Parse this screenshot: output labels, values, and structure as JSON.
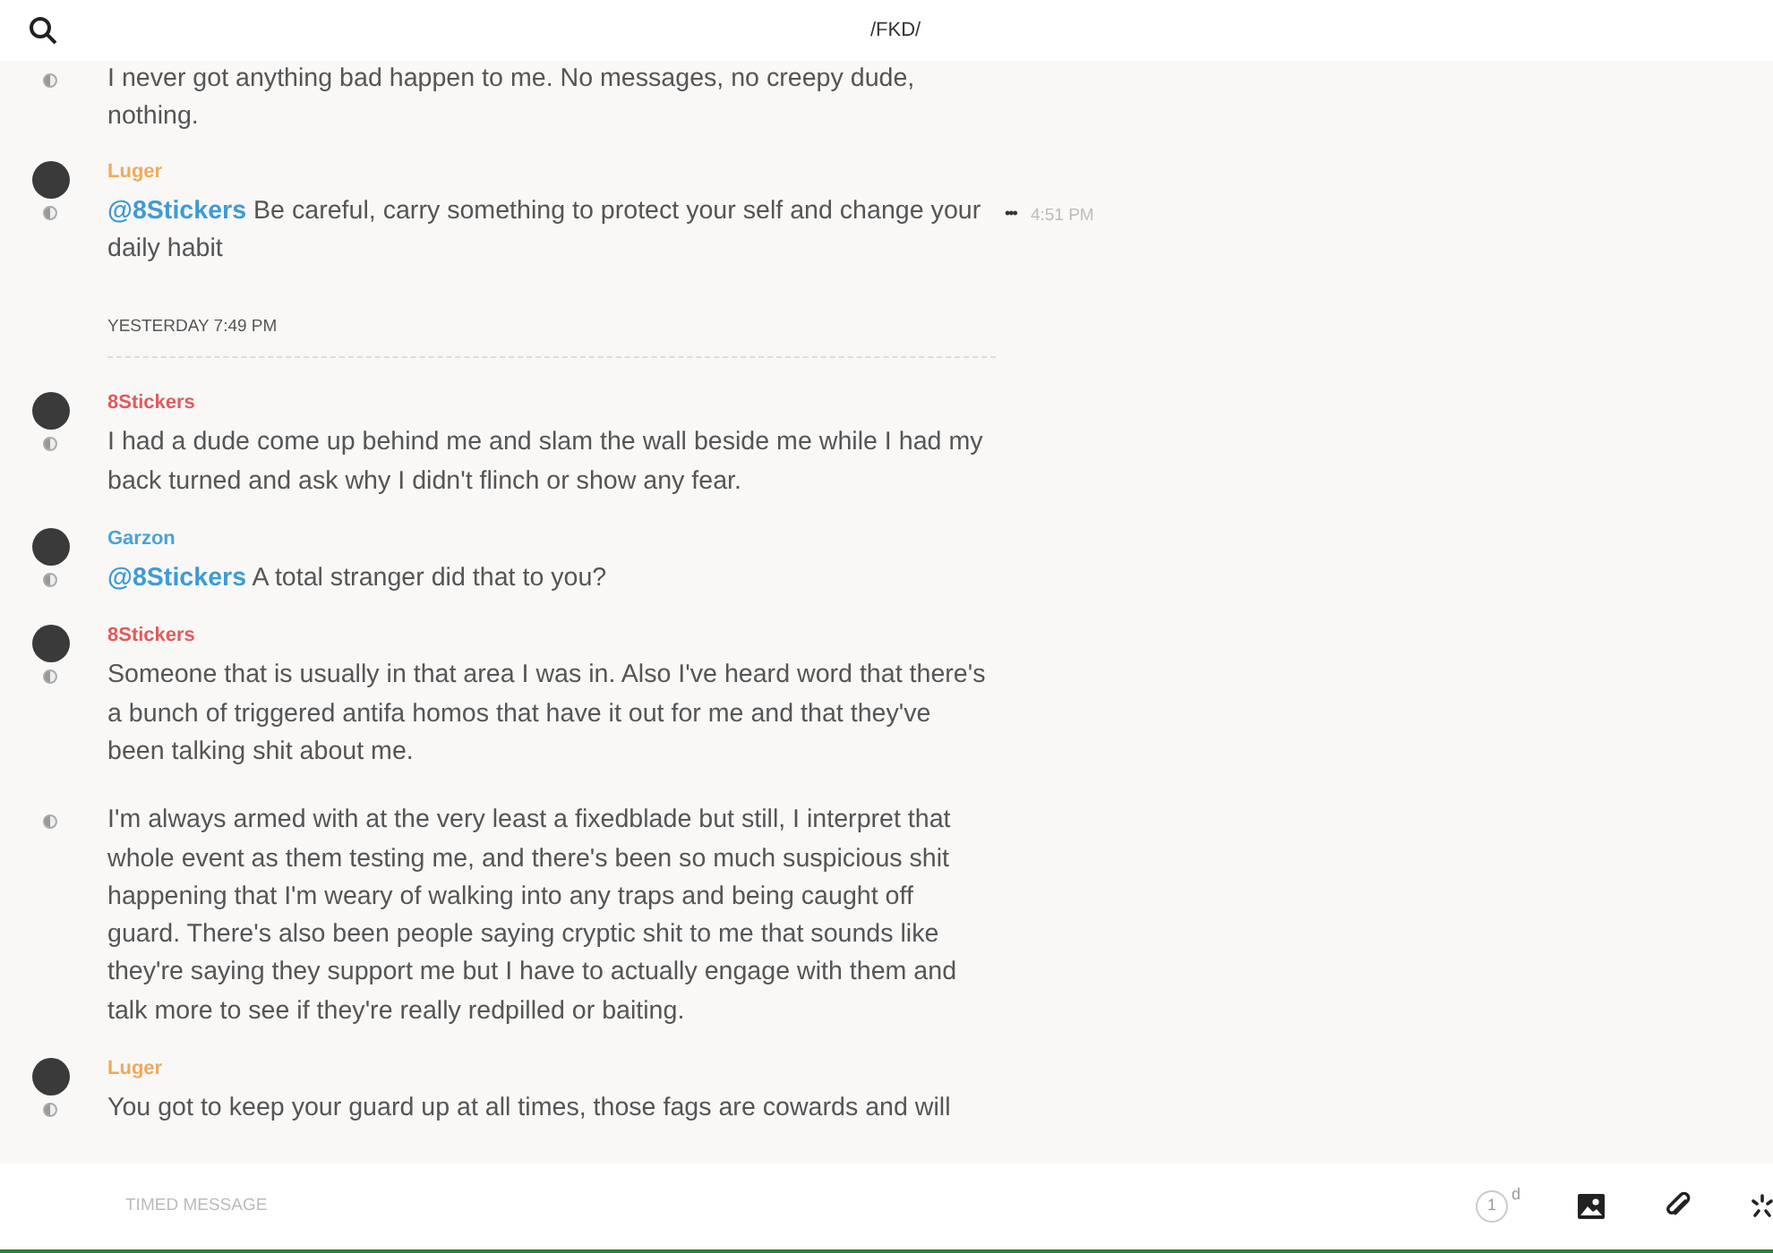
{
  "header": {
    "title": "/FKD/"
  },
  "feed": [
    {
      "kind": "group",
      "messages": [
        {
          "text": "I never got anything bad happen to me. No messages, no creepy dude, nothing."
        }
      ]
    },
    {
      "kind": "group",
      "author": "Luger",
      "color": "#f0a95a",
      "messages": [
        {
          "mention": "@8Stickers",
          "text": "Be careful, carry something to protect your self and change your daily habit",
          "time": "4:51 PM",
          "menu": "•••"
        }
      ]
    },
    {
      "kind": "divider",
      "label": "YESTERDAY 7:49 PM"
    },
    {
      "kind": "group",
      "author": "8Stickers",
      "color": "#e25b5b",
      "messages": [
        {
          "text": "I had a dude come up behind me and slam the wall beside me while I had my back turned and ask why I didn't flinch or show any fear."
        }
      ]
    },
    {
      "kind": "group",
      "author": "Garzon",
      "color": "#4aa3d6",
      "messages": [
        {
          "mention": "@8Stickers",
          "text": "A total stranger did that to you?"
        }
      ]
    },
    {
      "kind": "group",
      "author": "8Stickers",
      "color": "#e25b5b",
      "messages": [
        {
          "text": "Someone that is usually in that area I was in. Also I've heard word that there's a bunch of triggered antifa homos that have it out for me and that they've been talking shit about me."
        },
        {
          "text": "I'm always armed with at the very least a fixedblade but still, I interpret that whole event as them testing me, and there's been so much suspicious shit happening that I'm weary of walking into any traps and being caught off guard.  There's also been people saying cryptic shit to me that sounds like they're saying they support me but I have to actually engage with them and talk more to see if they're really redpilled or baiting."
        }
      ]
    },
    {
      "kind": "group",
      "author": "Luger",
      "color": "#f0a95a",
      "messages": [
        {
          "text": "You got to keep your guard up at all times, those fags are cowards and will"
        }
      ]
    }
  ],
  "composer": {
    "placeholder": "TIMED MESSAGE",
    "timer_count": "1",
    "timer_unit": "d"
  }
}
